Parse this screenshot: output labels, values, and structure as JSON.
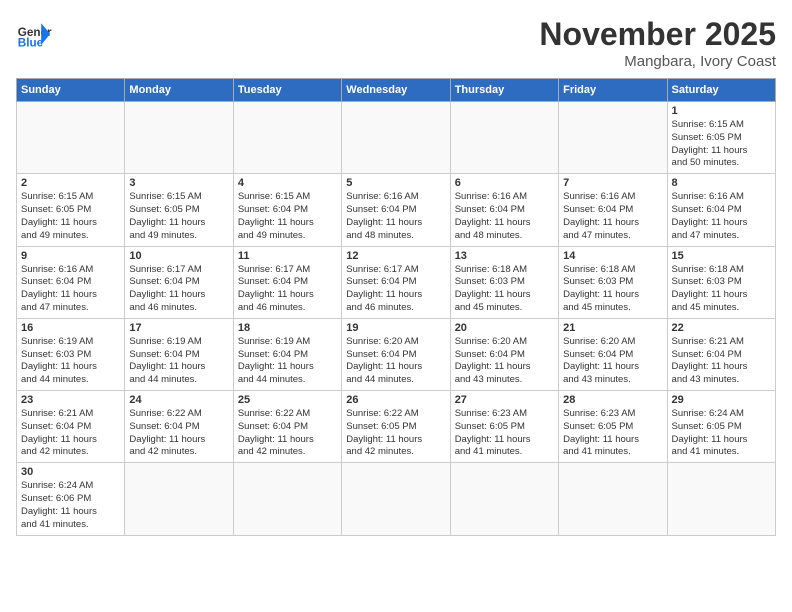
{
  "header": {
    "logo_general": "General",
    "logo_blue": "Blue",
    "month": "November 2025",
    "location": "Mangbara, Ivory Coast"
  },
  "days_of_week": [
    "Sunday",
    "Monday",
    "Tuesday",
    "Wednesday",
    "Thursday",
    "Friday",
    "Saturday"
  ],
  "weeks": [
    [
      {
        "day": "",
        "text": ""
      },
      {
        "day": "",
        "text": ""
      },
      {
        "day": "",
        "text": ""
      },
      {
        "day": "",
        "text": ""
      },
      {
        "day": "",
        "text": ""
      },
      {
        "day": "",
        "text": ""
      },
      {
        "day": "1",
        "text": "Sunrise: 6:15 AM\nSunset: 6:05 PM\nDaylight: 11 hours\nand 50 minutes."
      }
    ],
    [
      {
        "day": "2",
        "text": "Sunrise: 6:15 AM\nSunset: 6:05 PM\nDaylight: 11 hours\nand 49 minutes."
      },
      {
        "day": "3",
        "text": "Sunrise: 6:15 AM\nSunset: 6:05 PM\nDaylight: 11 hours\nand 49 minutes."
      },
      {
        "day": "4",
        "text": "Sunrise: 6:15 AM\nSunset: 6:04 PM\nDaylight: 11 hours\nand 49 minutes."
      },
      {
        "day": "5",
        "text": "Sunrise: 6:16 AM\nSunset: 6:04 PM\nDaylight: 11 hours\nand 48 minutes."
      },
      {
        "day": "6",
        "text": "Sunrise: 6:16 AM\nSunset: 6:04 PM\nDaylight: 11 hours\nand 48 minutes."
      },
      {
        "day": "7",
        "text": "Sunrise: 6:16 AM\nSunset: 6:04 PM\nDaylight: 11 hours\nand 47 minutes."
      },
      {
        "day": "8",
        "text": "Sunrise: 6:16 AM\nSunset: 6:04 PM\nDaylight: 11 hours\nand 47 minutes."
      }
    ],
    [
      {
        "day": "9",
        "text": "Sunrise: 6:16 AM\nSunset: 6:04 PM\nDaylight: 11 hours\nand 47 minutes."
      },
      {
        "day": "10",
        "text": "Sunrise: 6:17 AM\nSunset: 6:04 PM\nDaylight: 11 hours\nand 46 minutes."
      },
      {
        "day": "11",
        "text": "Sunrise: 6:17 AM\nSunset: 6:04 PM\nDaylight: 11 hours\nand 46 minutes."
      },
      {
        "day": "12",
        "text": "Sunrise: 6:17 AM\nSunset: 6:04 PM\nDaylight: 11 hours\nand 46 minutes."
      },
      {
        "day": "13",
        "text": "Sunrise: 6:18 AM\nSunset: 6:03 PM\nDaylight: 11 hours\nand 45 minutes."
      },
      {
        "day": "14",
        "text": "Sunrise: 6:18 AM\nSunset: 6:03 PM\nDaylight: 11 hours\nand 45 minutes."
      },
      {
        "day": "15",
        "text": "Sunrise: 6:18 AM\nSunset: 6:03 PM\nDaylight: 11 hours\nand 45 minutes."
      }
    ],
    [
      {
        "day": "16",
        "text": "Sunrise: 6:19 AM\nSunset: 6:03 PM\nDaylight: 11 hours\nand 44 minutes."
      },
      {
        "day": "17",
        "text": "Sunrise: 6:19 AM\nSunset: 6:04 PM\nDaylight: 11 hours\nand 44 minutes."
      },
      {
        "day": "18",
        "text": "Sunrise: 6:19 AM\nSunset: 6:04 PM\nDaylight: 11 hours\nand 44 minutes."
      },
      {
        "day": "19",
        "text": "Sunrise: 6:20 AM\nSunset: 6:04 PM\nDaylight: 11 hours\nand 44 minutes."
      },
      {
        "day": "20",
        "text": "Sunrise: 6:20 AM\nSunset: 6:04 PM\nDaylight: 11 hours\nand 43 minutes."
      },
      {
        "day": "21",
        "text": "Sunrise: 6:20 AM\nSunset: 6:04 PM\nDaylight: 11 hours\nand 43 minutes."
      },
      {
        "day": "22",
        "text": "Sunrise: 6:21 AM\nSunset: 6:04 PM\nDaylight: 11 hours\nand 43 minutes."
      }
    ],
    [
      {
        "day": "23",
        "text": "Sunrise: 6:21 AM\nSunset: 6:04 PM\nDaylight: 11 hours\nand 42 minutes."
      },
      {
        "day": "24",
        "text": "Sunrise: 6:22 AM\nSunset: 6:04 PM\nDaylight: 11 hours\nand 42 minutes."
      },
      {
        "day": "25",
        "text": "Sunrise: 6:22 AM\nSunset: 6:04 PM\nDaylight: 11 hours\nand 42 minutes."
      },
      {
        "day": "26",
        "text": "Sunrise: 6:22 AM\nSunset: 6:05 PM\nDaylight: 11 hours\nand 42 minutes."
      },
      {
        "day": "27",
        "text": "Sunrise: 6:23 AM\nSunset: 6:05 PM\nDaylight: 11 hours\nand 41 minutes."
      },
      {
        "day": "28",
        "text": "Sunrise: 6:23 AM\nSunset: 6:05 PM\nDaylight: 11 hours\nand 41 minutes."
      },
      {
        "day": "29",
        "text": "Sunrise: 6:24 AM\nSunset: 6:05 PM\nDaylight: 11 hours\nand 41 minutes."
      }
    ],
    [
      {
        "day": "30",
        "text": "Sunrise: 6:24 AM\nSunset: 6:06 PM\nDaylight: 11 hours\nand 41 minutes."
      },
      {
        "day": "",
        "text": ""
      },
      {
        "day": "",
        "text": ""
      },
      {
        "day": "",
        "text": ""
      },
      {
        "day": "",
        "text": ""
      },
      {
        "day": "",
        "text": ""
      },
      {
        "day": "",
        "text": ""
      }
    ]
  ]
}
